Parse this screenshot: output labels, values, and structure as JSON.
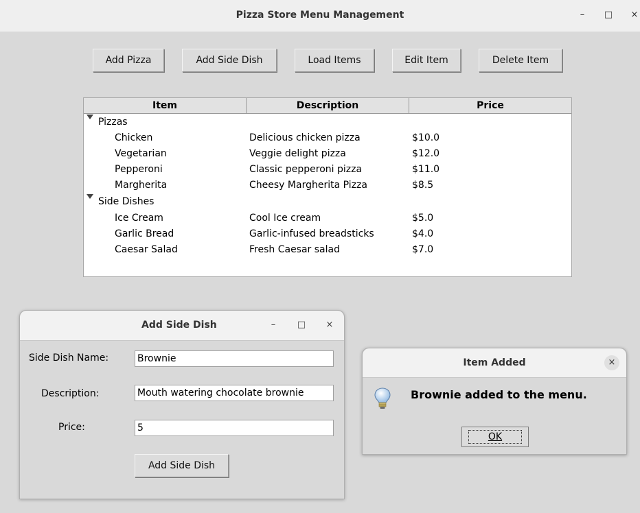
{
  "window": {
    "title": "Pizza Store Menu Management",
    "controls": [
      "–",
      "□",
      "×"
    ]
  },
  "toolbar": {
    "add_pizza": "Add Pizza",
    "add_side_dish": "Add Side Dish",
    "load_items": "Load Items",
    "edit_item": "Edit Item",
    "delete_item": "Delete Item"
  },
  "tree": {
    "headers": [
      "Item",
      "Description",
      "Price"
    ],
    "groups": [
      {
        "name": "Pizzas",
        "items": [
          {
            "name": "Chicken",
            "description": "Delicious chicken pizza",
            "price": "$10.0"
          },
          {
            "name": "Vegetarian",
            "description": "Veggie delight pizza",
            "price": "$12.0"
          },
          {
            "name": "Pepperoni",
            "description": "Classic pepperoni pizza",
            "price": "$11.0"
          },
          {
            "name": "Margherita",
            "description": "Cheesy Margherita Pizza",
            "price": "$8.5"
          }
        ]
      },
      {
        "name": "Side Dishes",
        "items": [
          {
            "name": "Ice Cream",
            "description": "Cool Ice cream",
            "price": "$5.0"
          },
          {
            "name": "Garlic Bread",
            "description": "Garlic-infused breadsticks",
            "price": "$4.0"
          },
          {
            "name": "Caesar Salad",
            "description": "Fresh Caesar salad",
            "price": "$7.0"
          }
        ]
      }
    ]
  },
  "side_dish_dialog": {
    "title": "Add Side Dish",
    "controls": [
      "–",
      "□",
      "×"
    ],
    "name_label": "Side Dish Name:",
    "name_value": "Brownie",
    "description_label": "Description:",
    "description_value": "Mouth watering chocolate brownie",
    "price_label": "Price:",
    "price_value": "5",
    "submit_label": "Add Side Dish"
  },
  "message_box": {
    "title": "Item Added",
    "close": "×",
    "message": "Brownie added to the menu.",
    "ok_label": "OK"
  }
}
